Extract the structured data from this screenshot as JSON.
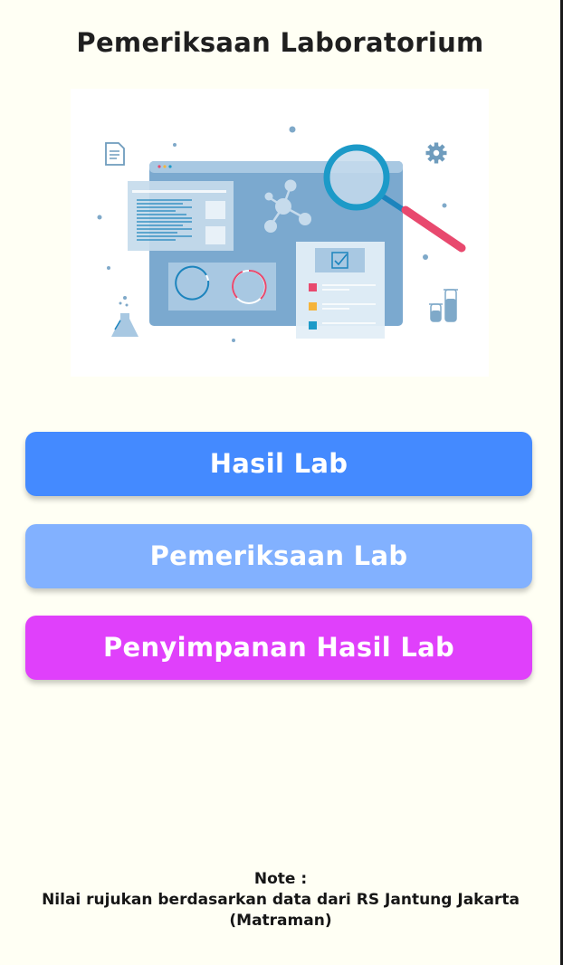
{
  "page": {
    "title": "Pemeriksaan Laboratorium"
  },
  "illustration": {
    "icon": "laboratory-illustration"
  },
  "buttons": [
    {
      "label": "Hasil Lab",
      "color": "#448aff"
    },
    {
      "label": "Pemeriksaan Lab",
      "color": "#82b1ff"
    },
    {
      "label": "Penyimpanan Hasil Lab",
      "color": "#e040fb"
    }
  ],
  "note": {
    "heading": "Note :",
    "text": "Nilai rujukan berdasarkan data dari RS Jantung Jakarta (Matraman)"
  },
  "colors": {
    "background": "#fffff4",
    "title_text": "#1f1f1f"
  }
}
